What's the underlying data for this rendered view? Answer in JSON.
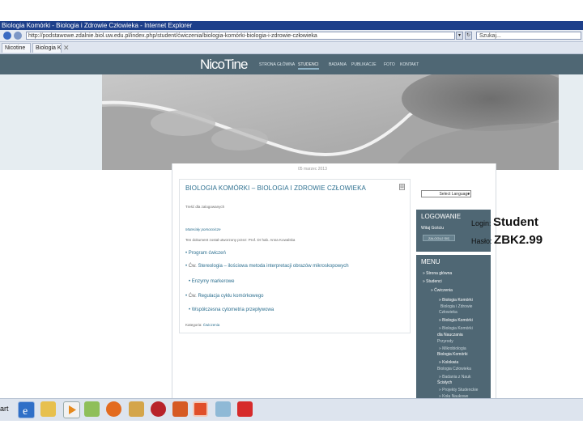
{
  "browser": {
    "window_title": "Biologia Komórki - Biologia i Zdrowie Człowieka - Internet Explorer",
    "address": "http://podstawowe.zdalnie.biol.uw.edu.pl/index.php/student/ćwiczenia/biologia-komórki-biologia-i-zdrowie-człowieka",
    "search_placeholder": "Szukaj...",
    "tabs": [
      {
        "label": "Nicotine"
      },
      {
        "label": "Biologia Komórki..."
      }
    ]
  },
  "site": {
    "logo": "NicoTine",
    "nav": [
      {
        "label": "STRONA GŁÓWNA"
      },
      {
        "label": "STUDENCI"
      },
      {
        "label": "BADANIA"
      },
      {
        "label": "PUBLIKACJE"
      },
      {
        "label": "FOTO"
      },
      {
        "label": "KONTAKT"
      }
    ],
    "dateline": "05 marzec 2013"
  },
  "article": {
    "title": "BIOLOGIA KOMÓRKI – BIOLOGIA I ZDROWIE CZŁOWIEKA",
    "access_note": "Treść dla zalogowanych",
    "materials_label": "Materiały pomocnicze",
    "author_line": "Ten dokument został utworzony przez: Prof. Dr hab. Anna Kowalska",
    "items": [
      {
        "label": "Program ćwiczeń"
      },
      {
        "prefix": "Ćw.",
        "label": "Stereologia – ilościowa metoda interpretacji obrazów mikroskopowych"
      },
      {
        "label": "Enzymy markerowe"
      },
      {
        "prefix": "Ćw.",
        "label": "Regulacja cyklu komórkowego"
      },
      {
        "label": "Współczesna cytometria przepływowa"
      }
    ],
    "category_label": "Kategoria:",
    "category_value": "Ćwiczenia"
  },
  "sidebar": {
    "language_select": "Select Language",
    "login_title": "LOGOWANIE",
    "welcome": "Witaj Gościu",
    "login_button": "ZALOGUJ SIĘ",
    "menu_title": "MENU",
    "menu_items": [
      {
        "label": "Strona główna"
      },
      {
        "label": "Studenci"
      },
      {
        "label": "Ćwiczenia"
      },
      {
        "label": "Biologia Komórki"
      },
      {
        "label": "Biologia i Zdrowie"
      },
      {
        "label": "Człowieka"
      },
      {
        "label": "Biologia Komórki"
      },
      {
        "label": "dla Nauczania"
      },
      {
        "label": "Przyrody"
      },
      {
        "label": "Mikrobiologia"
      },
      {
        "label": "Biologia Komórki"
      },
      {
        "label": "Kolokwia"
      },
      {
        "label": "Biologia Człowieka"
      },
      {
        "label": "Badania z Nauk"
      },
      {
        "label": "Ścisłych"
      },
      {
        "label": "Projekty Studenckie"
      },
      {
        "label": "Koła Naukowe"
      }
    ]
  },
  "credentials": {
    "login_label": "Login:",
    "login_value": "Student",
    "password_label": "Hasło:",
    "password_value": "ZBK2.99"
  },
  "taskbar": {
    "start_label": "art",
    "icons": [
      "internet-explorer-icon",
      "file-explorer-icon",
      "media-player-icon",
      "paint-icon",
      "firefox-icon",
      "people-icon",
      "chrome-icon",
      "powerpoint-icon",
      "ppt-icon",
      "window-icon",
      "acrobat-icon"
    ]
  },
  "colors": {
    "nav": "#4f6774",
    "title_bar": "#1d3f8a",
    "link": "#2c6f8f"
  }
}
